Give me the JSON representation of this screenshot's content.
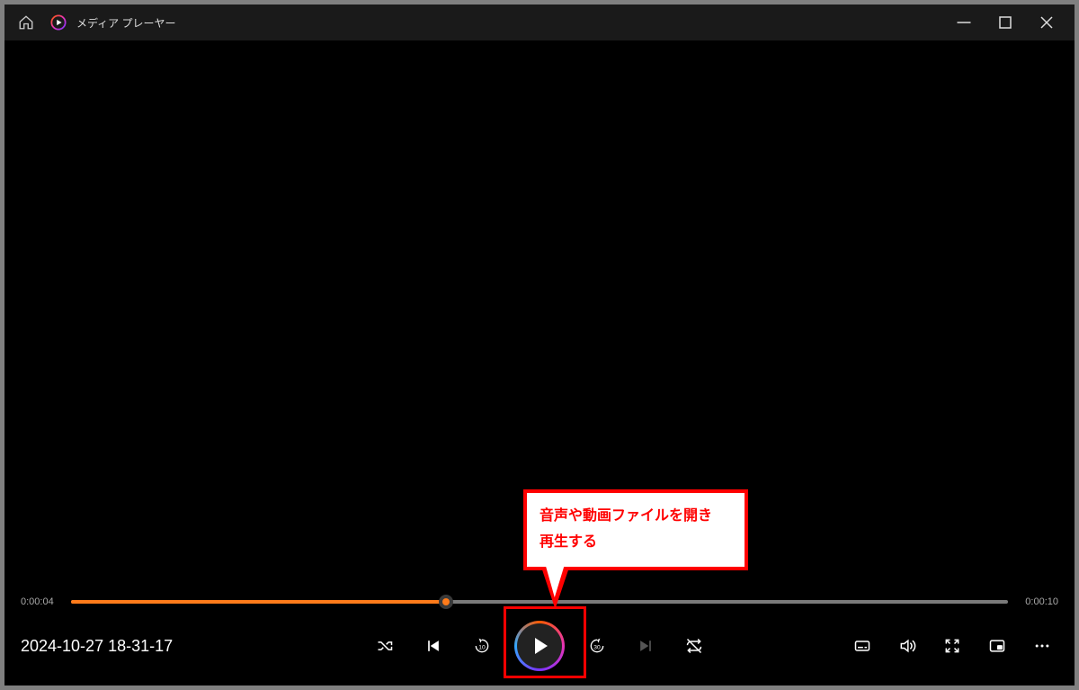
{
  "titlebar": {
    "app_title": "メディア プレーヤー"
  },
  "playback": {
    "current_time": "0:00:04",
    "total_time": "0:00:10",
    "file_name": "2024-10-27 18-31-17",
    "progress_percent": 40,
    "skip_back_seconds": "10",
    "skip_forward_seconds": "30"
  },
  "annotation": {
    "line1": "音声や動画ファイルを開き",
    "line2": "再生する"
  }
}
